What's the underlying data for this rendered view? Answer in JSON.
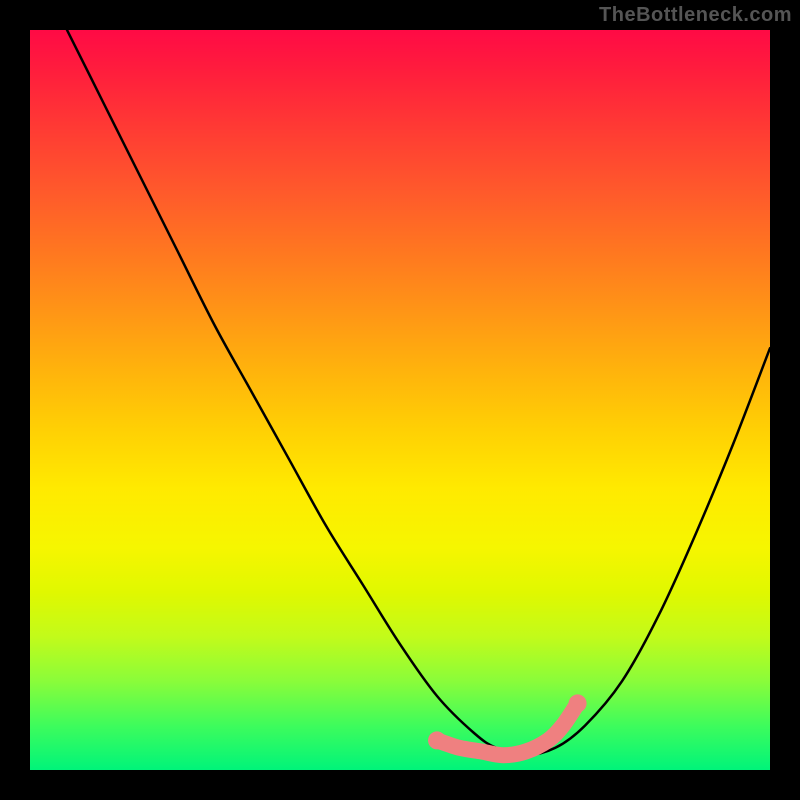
{
  "watermark": "TheBottleneck.com",
  "chart_data": {
    "type": "line",
    "title": "",
    "xlabel": "",
    "ylabel": "",
    "xlim": [
      0,
      100
    ],
    "ylim": [
      0,
      100
    ],
    "grid": false,
    "legend": null,
    "series": [
      {
        "name": "black-curve",
        "color": "#000000",
        "x": [
          5,
          10,
          15,
          20,
          25,
          30,
          35,
          40,
          45,
          50,
          55,
          60,
          63,
          67,
          71,
          75,
          80,
          85,
          90,
          95,
          100
        ],
        "y": [
          100,
          90,
          80,
          70,
          60,
          51,
          42,
          33,
          25,
          17,
          10,
          5,
          3,
          2,
          3,
          6,
          12,
          21,
          32,
          44,
          57
        ]
      },
      {
        "name": "pink-valley-marker",
        "color": "#ef8080",
        "x": [
          55,
          58,
          61,
          64,
          67,
          70,
          72,
          74
        ],
        "y": [
          4,
          3,
          2.5,
          2,
          2.5,
          4,
          6,
          9
        ]
      }
    ],
    "background_gradient": {
      "direction": "vertical",
      "stops": [
        {
          "pos": 0,
          "color": "#ff0a45"
        },
        {
          "pos": 50,
          "color": "#ffd000"
        },
        {
          "pos": 80,
          "color": "#e0f800"
        },
        {
          "pos": 100,
          "color": "#00f47a"
        }
      ]
    }
  }
}
